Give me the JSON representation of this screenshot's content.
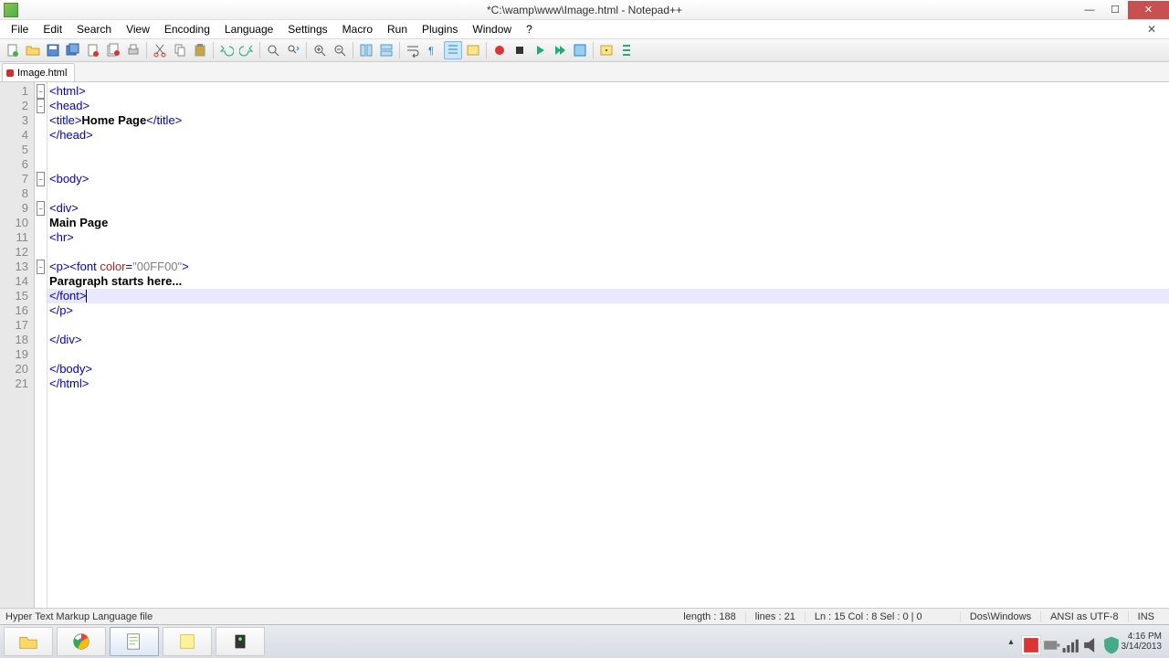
{
  "window": {
    "title": "*C:\\wamp\\www\\Image.html - Notepad++"
  },
  "menu": {
    "items": [
      "File",
      "Edit",
      "Search",
      "View",
      "Encoding",
      "Language",
      "Settings",
      "Macro",
      "Run",
      "Plugins",
      "Window",
      "?"
    ]
  },
  "tab": {
    "label": "Image.html"
  },
  "code": {
    "lines": [
      {
        "n": 1,
        "fold": "-",
        "html": "<span class='tag'>&lt;html&gt;</span>"
      },
      {
        "n": 2,
        "fold": "-",
        "html": "<span class='tag'>&lt;head&gt;</span>"
      },
      {
        "n": 3,
        "fold": "",
        "html": "<span class='tag'>&lt;title&gt;</span><span class='txt'>Home Page</span><span class='tag'>&lt;/title&gt;</span>"
      },
      {
        "n": 4,
        "fold": "",
        "html": "<span class='tag'>&lt;/head&gt;</span>"
      },
      {
        "n": 5,
        "fold": "",
        "html": ""
      },
      {
        "n": 6,
        "fold": "",
        "html": ""
      },
      {
        "n": 7,
        "fold": "-",
        "html": "<span class='tag'>&lt;body&gt;</span>"
      },
      {
        "n": 8,
        "fold": "",
        "html": ""
      },
      {
        "n": 9,
        "fold": "-",
        "html": "<span class='tag'>&lt;div&gt;</span>"
      },
      {
        "n": 10,
        "fold": "",
        "html": "<span class='txt'>Main Page</span>"
      },
      {
        "n": 11,
        "fold": "",
        "html": "<span class='tag'>&lt;hr&gt;</span>"
      },
      {
        "n": 12,
        "fold": "",
        "html": ""
      },
      {
        "n": 13,
        "fold": "-",
        "html": "<span class='tag'>&lt;p&gt;&lt;font</span> <span class='attr'>color</span><span class='tag'>=</span><span class='str'>\"00FF00\"</span><span class='tag'>&gt;</span>"
      },
      {
        "n": 14,
        "fold": "",
        "html": "<span class='txt'>Paragraph starts here...</span>"
      },
      {
        "n": 15,
        "fold": "",
        "hl": true,
        "html": "<span class='tag'>&lt;/font&gt;</span><span class='caret'></span>"
      },
      {
        "n": 16,
        "fold": "",
        "html": "<span class='tag'>&lt;/p&gt;</span>"
      },
      {
        "n": 17,
        "fold": "",
        "html": ""
      },
      {
        "n": 18,
        "fold": "",
        "html": "<span class='tag'>&lt;/div&gt;</span>"
      },
      {
        "n": 19,
        "fold": "",
        "html": ""
      },
      {
        "n": 20,
        "fold": "",
        "html": "<span class='tag'>&lt;/body&gt;</span>"
      },
      {
        "n": 21,
        "fold": "",
        "html": "<span class='tag'>&lt;/html&gt;</span>"
      }
    ]
  },
  "status": {
    "lang": "Hyper Text Markup Language file",
    "length": "length : 188",
    "lines": "lines : 21",
    "pos": "Ln : 15    Col : 8    Sel : 0 | 0",
    "eol": "Dos\\Windows",
    "enc": "ANSI as UTF-8",
    "mode": "INS"
  },
  "clock": {
    "time": "4:16 PM",
    "date": "3/14/2013"
  }
}
